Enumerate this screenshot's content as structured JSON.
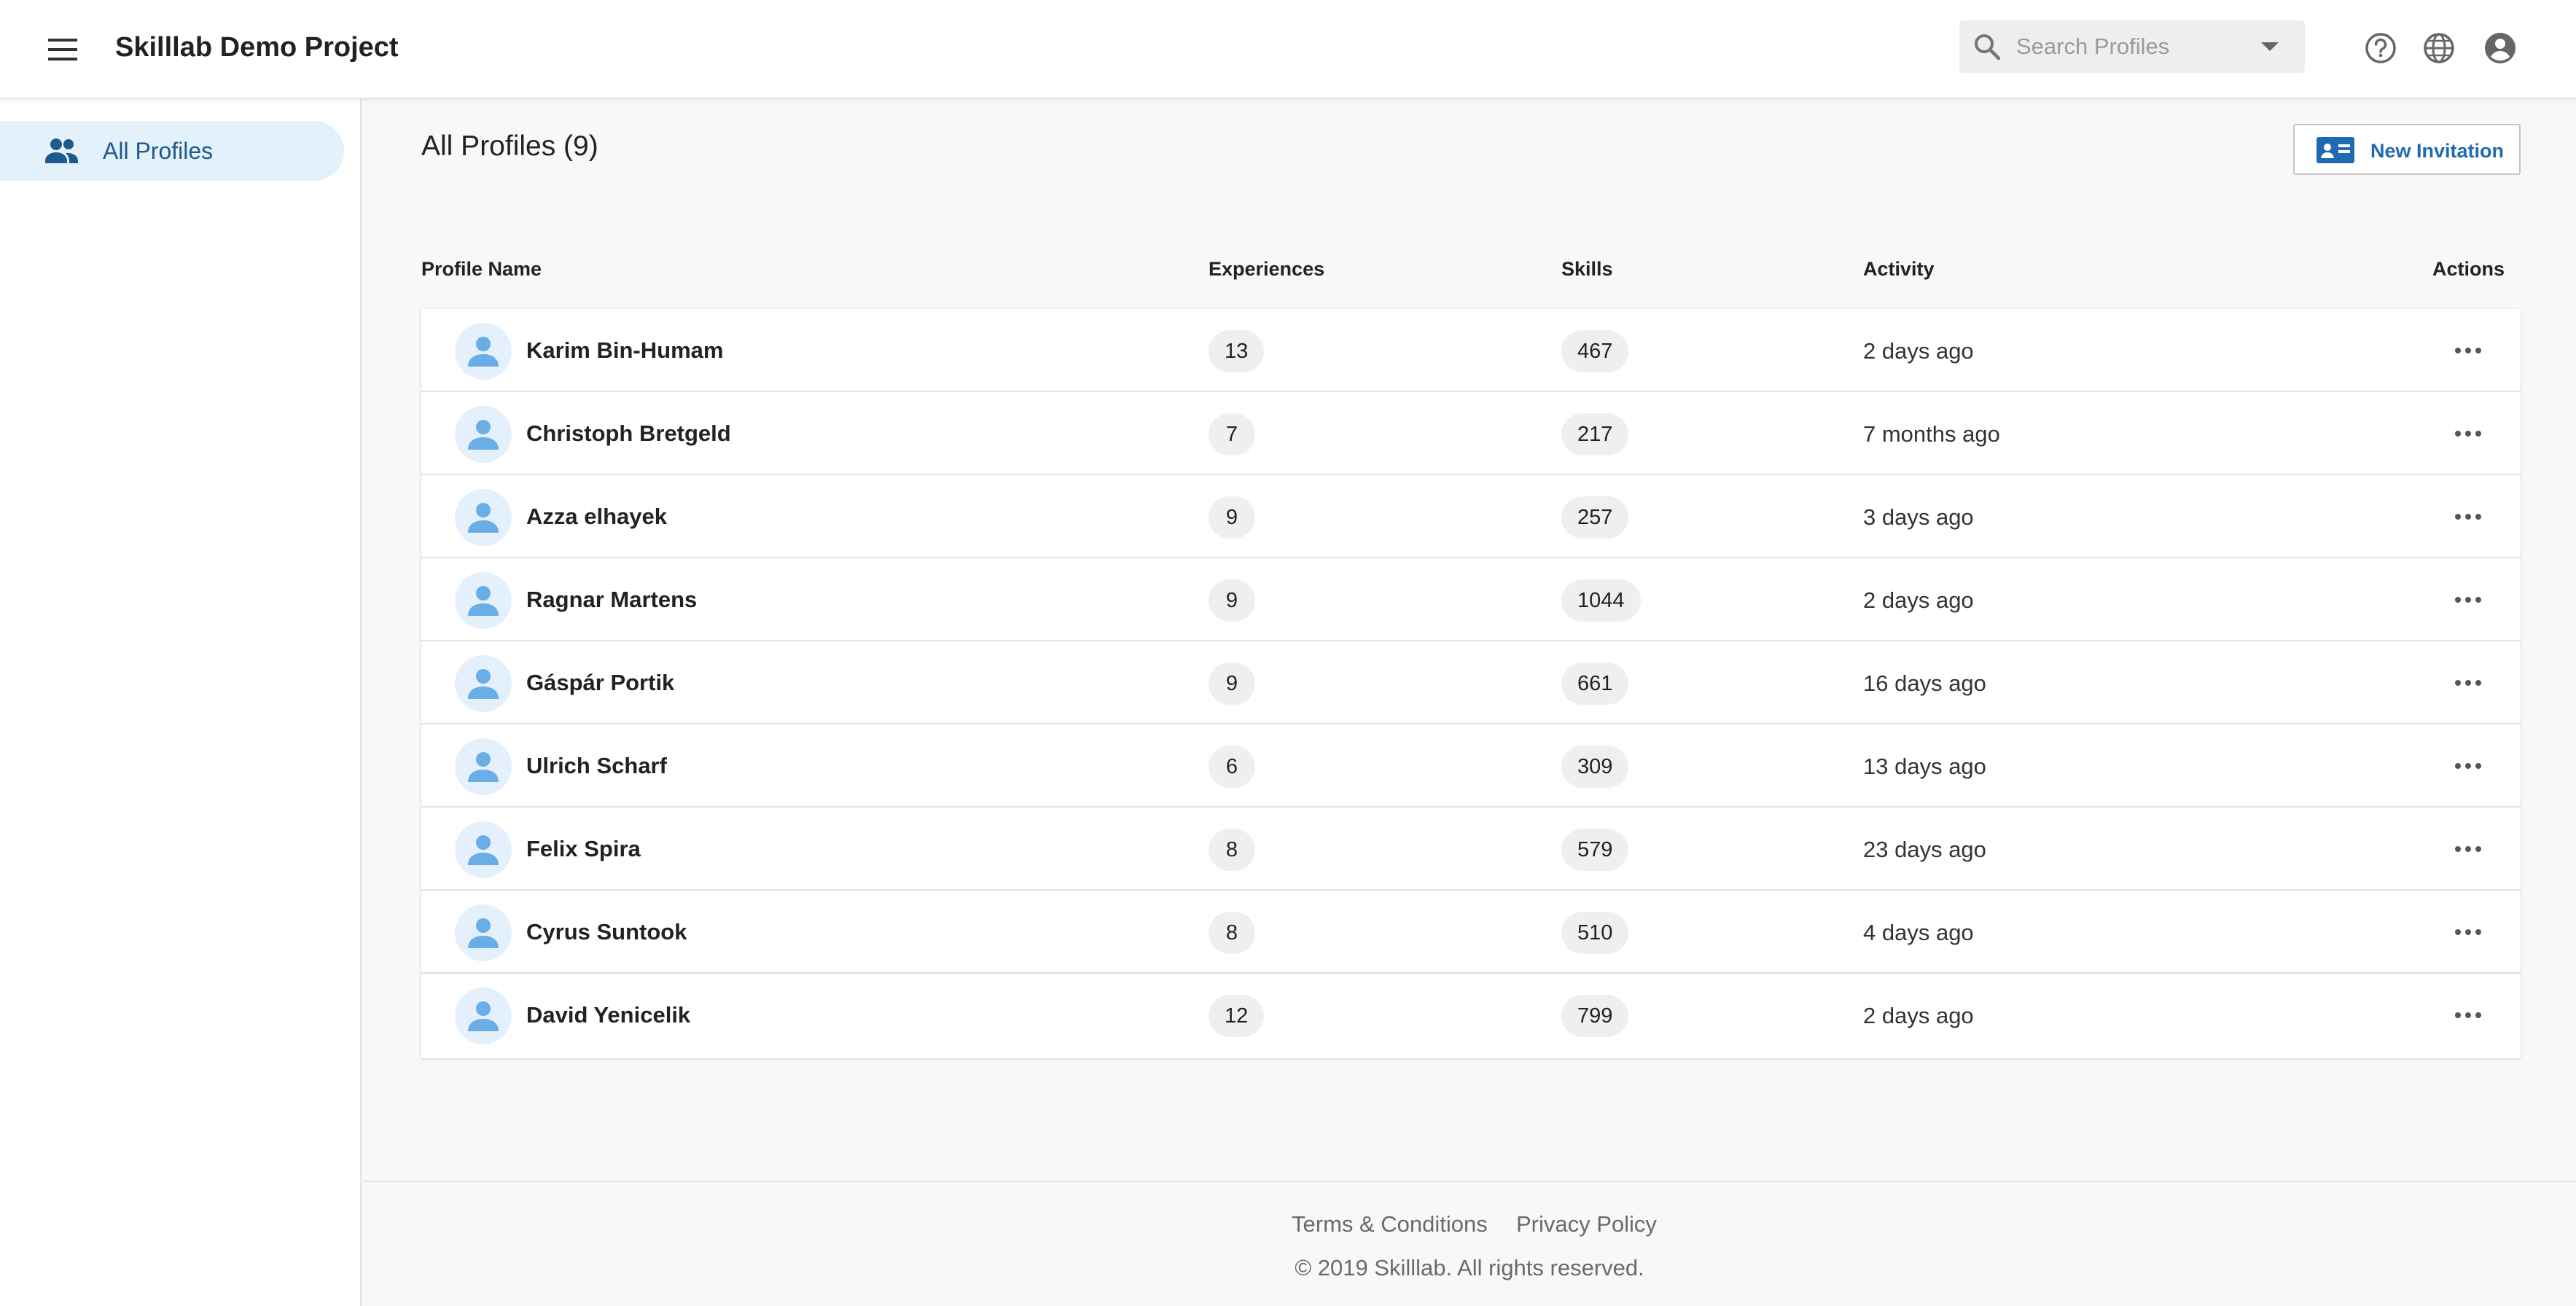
{
  "header": {
    "title": "Skilllab Demo Project",
    "search_placeholder": "Search Profiles",
    "icons": [
      "menu-icon",
      "search-icon",
      "chevron-down-icon",
      "help-icon",
      "globe-icon",
      "account-icon"
    ]
  },
  "sidebar": {
    "items": [
      {
        "label": "All Profiles",
        "icon": "people-icon",
        "active": true
      }
    ]
  },
  "main": {
    "title": "All Profiles (9)",
    "new_invitation_label": "New Invitation",
    "columns": {
      "name": "Profile Name",
      "experiences": "Experiences",
      "skills": "Skills",
      "activity": "Activity",
      "actions": "Actions"
    },
    "rows": [
      {
        "name": "Karim Bin-Humam",
        "experiences": "13",
        "skills": "467",
        "activity": "2 days ago"
      },
      {
        "name": "Christoph Bretgeld",
        "experiences": "7",
        "skills": "217",
        "activity": "7 months ago"
      },
      {
        "name": "Azza elhayek",
        "experiences": "9",
        "skills": "257",
        "activity": "3 days ago"
      },
      {
        "name": "Ragnar Martens",
        "experiences": "9",
        "skills": "1044",
        "activity": "2 days ago"
      },
      {
        "name": "Gáspár Portik",
        "experiences": "9",
        "skills": "661",
        "activity": "16 days ago"
      },
      {
        "name": "Ulrich Scharf",
        "experiences": "6",
        "skills": "309",
        "activity": "13 days ago"
      },
      {
        "name": "Felix Spira",
        "experiences": "8",
        "skills": "579",
        "activity": "23 days ago"
      },
      {
        "name": "Cyrus Suntook",
        "experiences": "8",
        "skills": "510",
        "activity": "4 days ago"
      },
      {
        "name": "David Yenicelik",
        "experiences": "12",
        "skills": "799",
        "activity": "2 days ago"
      }
    ]
  },
  "footer": {
    "terms": "Terms & Conditions",
    "privacy": "Privacy Policy",
    "copyright": "© 2019 Skilllab. All rights reserved."
  },
  "colors": {
    "accent": "#1e6bb0",
    "nav_active_bg": "#e3f1fb",
    "avatar_icon": "#6aaee8"
  }
}
